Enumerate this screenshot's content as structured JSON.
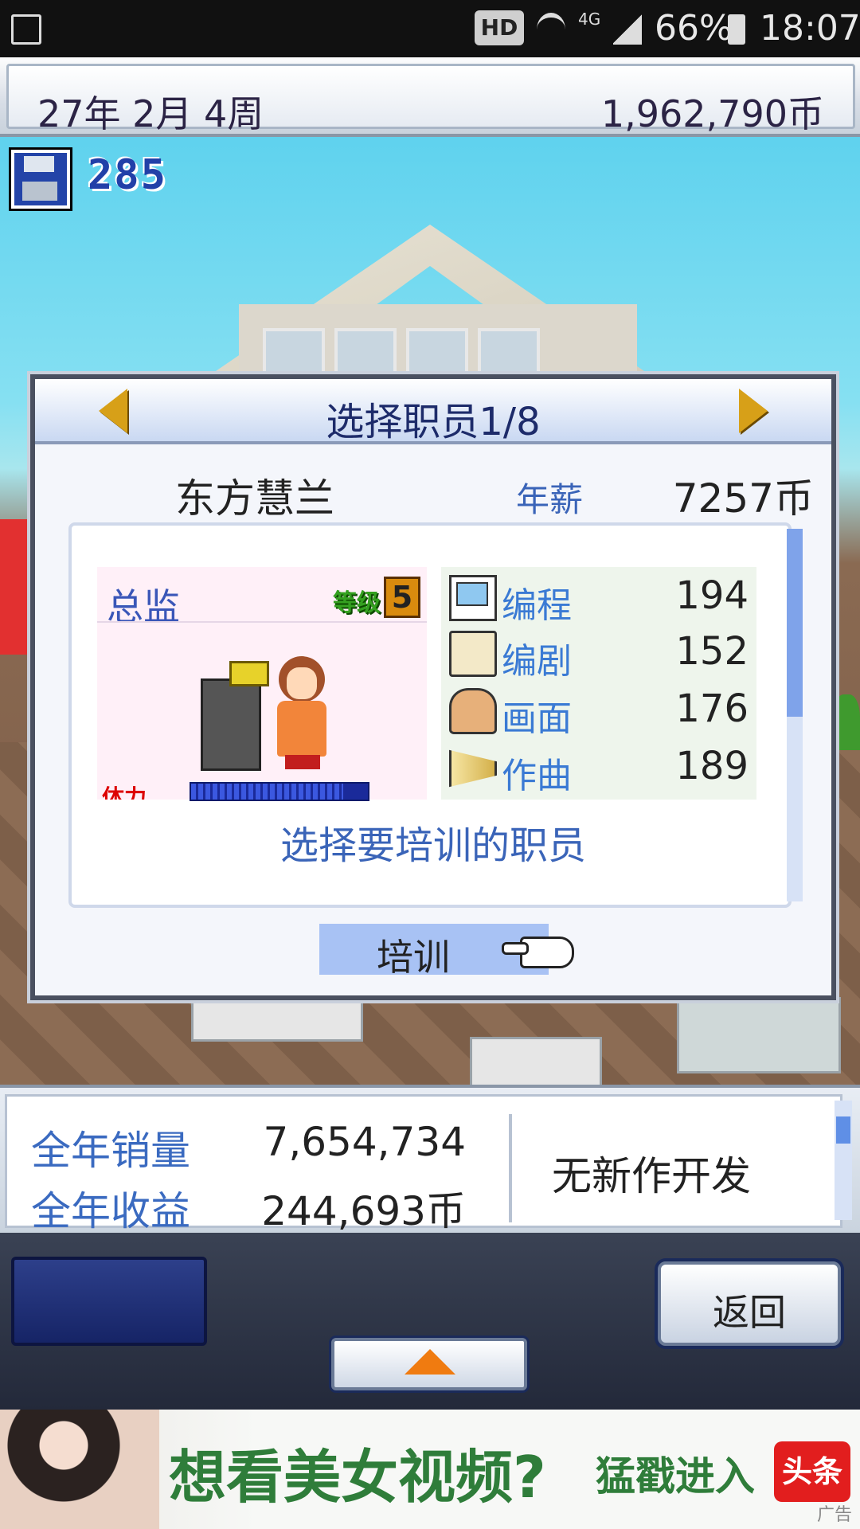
{
  "status_bar": {
    "network_badge": "HD",
    "network_type": "4G",
    "battery": "66%",
    "time": "18:07",
    "icons": [
      "image-icon",
      "wifi-icon",
      "signal-icon",
      "battery-icon"
    ]
  },
  "top_bar": {
    "date": "27年 2月 4周",
    "money": "1,962,790币"
  },
  "save": {
    "icon": "floppy-disk-icon",
    "count": "285"
  },
  "dialog": {
    "title": "选择职员1/8",
    "staff_name": "东方慧兰",
    "salary_label": "年薪",
    "salary_value": "7257币",
    "role": "总监",
    "level_label": "等级",
    "level_value": "5",
    "hp_label": "体力",
    "hp_fraction": 0.86,
    "stats": [
      {
        "name": "编程",
        "value": "194",
        "icon": "computer-icon"
      },
      {
        "name": "编剧",
        "value": "152",
        "icon": "book-icon"
      },
      {
        "name": "画面",
        "value": "176",
        "icon": "paint-palette-icon"
      },
      {
        "name": "作曲",
        "value": "189",
        "icon": "trumpet-icon"
      }
    ],
    "prompt": "选择要培训的职员",
    "train_button": "培训"
  },
  "bottom_panel": {
    "sales_label": "全年销量",
    "sales_value": "7,654,734",
    "revenue_label": "全年收益",
    "revenue_value": "244,693币",
    "dev_status": "无新作开发"
  },
  "nav": {
    "back_button": "返回"
  },
  "ad": {
    "text": "想看美女视频?",
    "cta": "猛戳进入",
    "logo": "头条",
    "tag": "广告"
  },
  "colors": {
    "accent_blue": "#3a64b8",
    "dialog_title": "#1d2b6a",
    "arrow_gold": "#d7a018",
    "train_highlight": "#a8c2f4",
    "ad_green": "#2f7d3a"
  }
}
